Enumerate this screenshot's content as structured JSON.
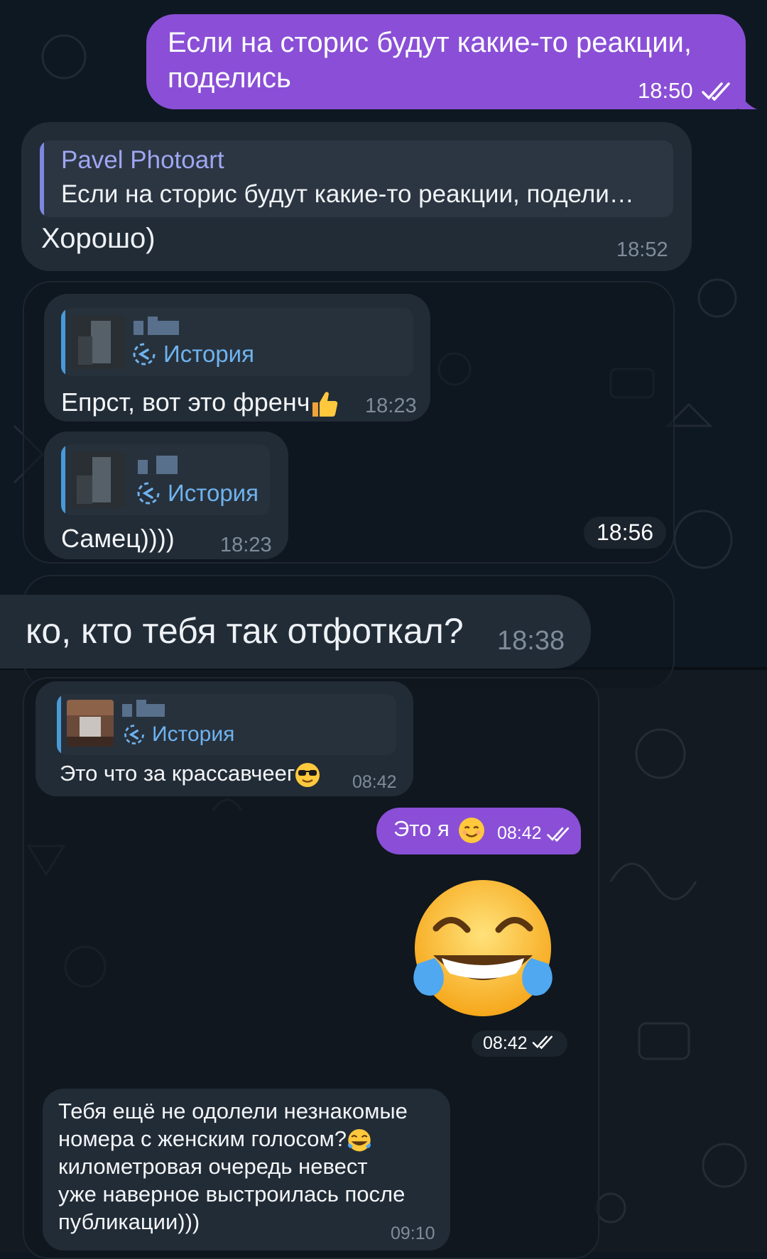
{
  "screen1": {
    "out_message": {
      "line1": "Если на сторис будут какие-то реакции,",
      "line2": "поделись",
      "time": "18:50"
    },
    "reply_message": {
      "quoted_name": "Pavel Photoart",
      "quoted_text": "Если на сторис будут какие-то реакции, подели…",
      "text": "Хорошо)",
      "time": "18:52"
    },
    "story_replies": [
      {
        "story_label": "История",
        "text": "Епрст, вот это френч",
        "time": "18:23"
      },
      {
        "story_label": "История",
        "text": "Самец))))",
        "time": "18:23"
      }
    ],
    "story_block_time": "18:56",
    "partial_message": {
      "text": "ко, кто тебя так отфоткал?",
      "time": "18:38"
    }
  },
  "screen2": {
    "story_reply": {
      "story_label": "История",
      "text": "Это что за красcавчеег",
      "time": "08:42"
    },
    "out_message": {
      "text": "Это я",
      "time": "08:42"
    },
    "sticker_time": "08:42",
    "last_message": {
      "line1": "Тебя ещё не одолели незнакомые",
      "line2": "номера с женским голосом?",
      "line3": "километровая очередь невест",
      "line4": "уже наверное выстроилась после",
      "line5": "публикации)))",
      "time": "09:10"
    }
  },
  "icons": [
    "double-check-icon",
    "story-reply-icon",
    "thumbs-up-emoji",
    "sunglasses-emoji",
    "smile-emoji",
    "laughing-tears-emoji"
  ],
  "colors": {
    "outgoing": "#8a4fd6",
    "incoming": "#222c37",
    "accent_name": "#9fa6f2",
    "story_link": "#6fb3ee"
  }
}
